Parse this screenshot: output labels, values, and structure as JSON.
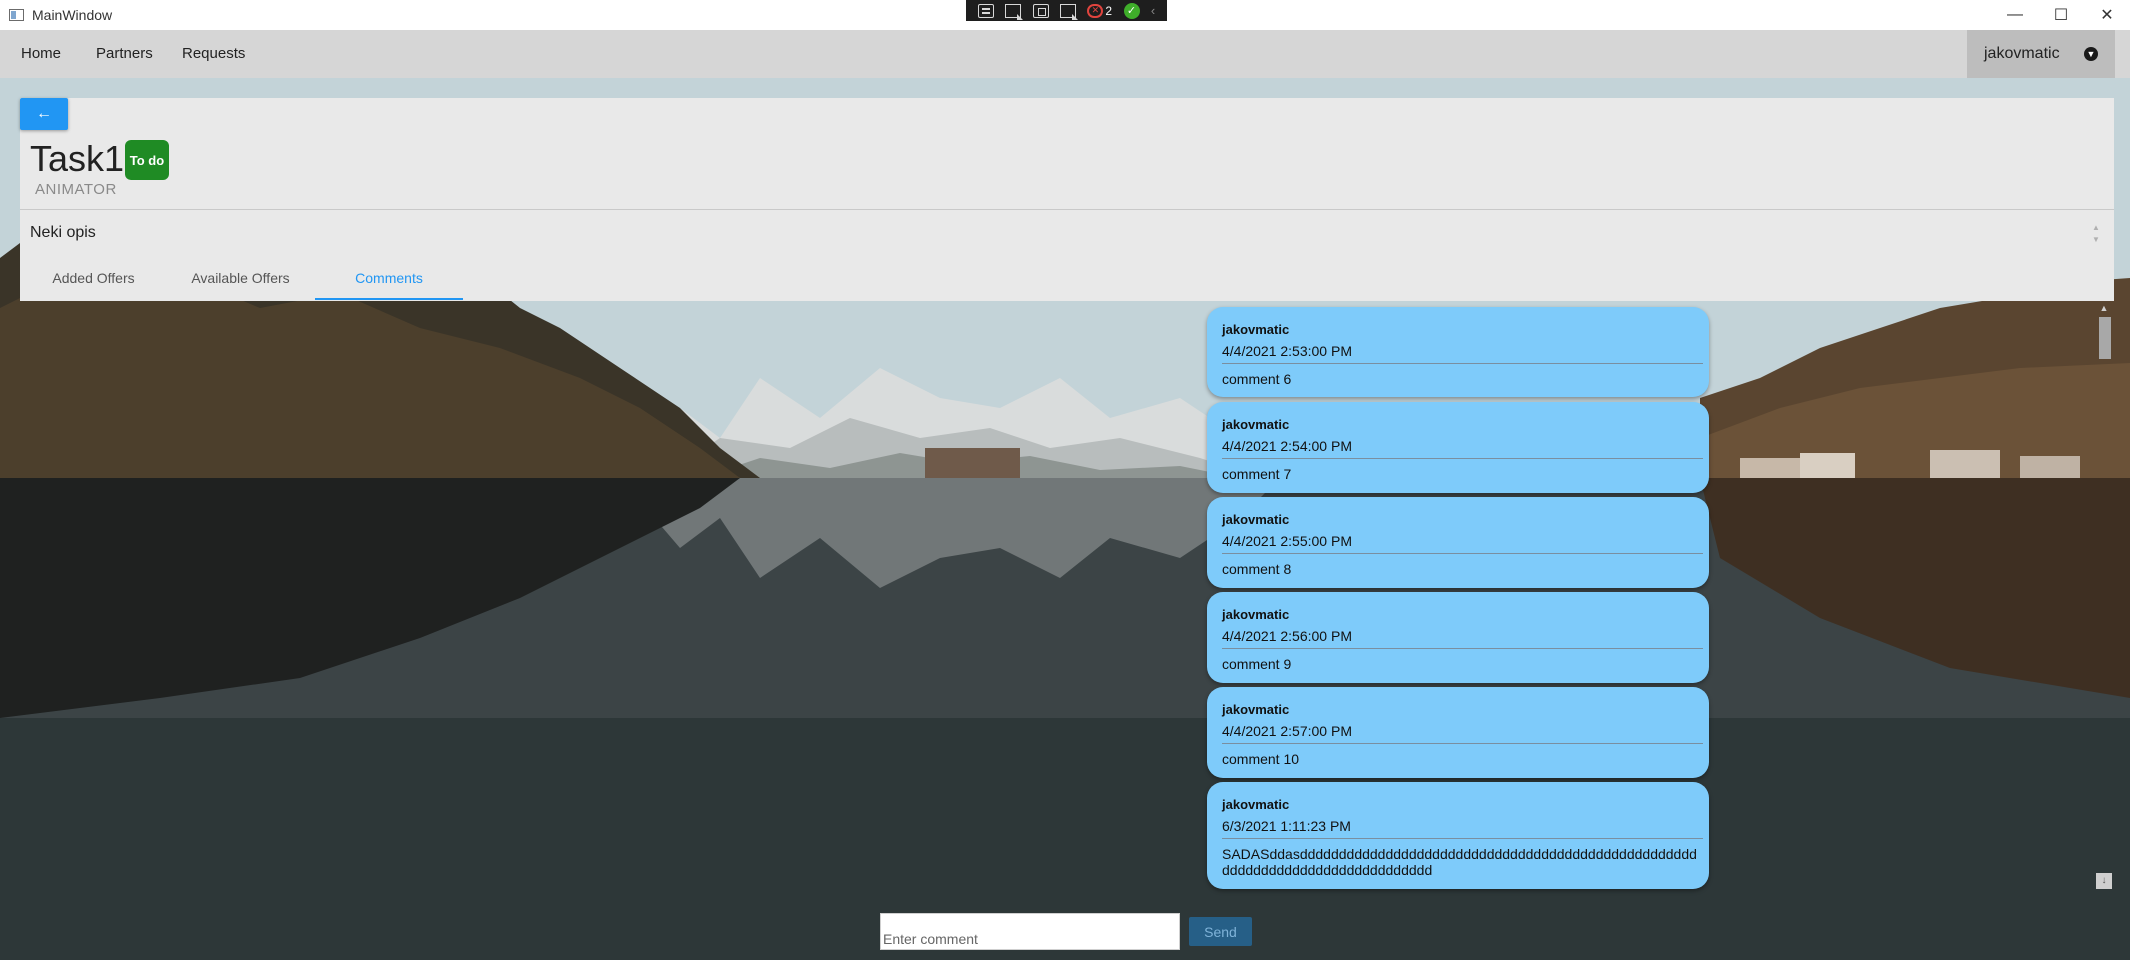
{
  "window": {
    "title": "MainWindow",
    "controls": {
      "minimize": "—",
      "maximize": "☐",
      "close": "✕"
    }
  },
  "debug_toolbar": {
    "error_count": "2"
  },
  "navbar": {
    "items": [
      {
        "label": "Home"
      },
      {
        "label": "Partners"
      },
      {
        "label": "Requests"
      }
    ],
    "user": {
      "name": "jakovmatic"
    }
  },
  "task": {
    "title": "Task1",
    "status": "To do",
    "status_color": "#1f8b24",
    "role": "ANIMATOR",
    "description": "Neki opis"
  },
  "tabs": [
    {
      "label": "Added Offers",
      "active": false
    },
    {
      "label": "Available Offers",
      "active": false
    },
    {
      "label": "Comments",
      "active": true
    }
  ],
  "comments": [
    {
      "author": "jakovmatic",
      "date": "4/4/2021 2:53:00 PM",
      "text": "comment 6"
    },
    {
      "author": "jakovmatic",
      "date": "4/4/2021 2:54:00 PM",
      "text": "comment 7"
    },
    {
      "author": "jakovmatic",
      "date": "4/4/2021 2:55:00 PM",
      "text": "comment 8"
    },
    {
      "author": "jakovmatic",
      "date": "4/4/2021 2:56:00 PM",
      "text": "comment 9"
    },
    {
      "author": "jakovmatic",
      "date": "4/4/2021 2:57:00 PM",
      "text": "comment 10"
    },
    {
      "author": "jakovmatic",
      "date": "6/3/2021 1:11:23 PM",
      "text": "SADASddasdddddddddddddddddddddddddddddddddddddddddddddddddddddddddddddddddddddddddddddd"
    }
  ],
  "composer": {
    "placeholder": "Enter comment",
    "send_label": "Send"
  },
  "colors": {
    "accent": "#2196f3",
    "comment_bubble": "#7ecbfa",
    "navbar": "#d6d6d6"
  }
}
